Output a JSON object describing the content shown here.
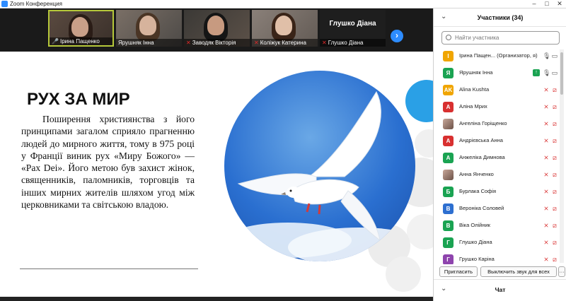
{
  "window": {
    "title": "Zoom Конференция",
    "controls": [
      "–",
      "□",
      "✕"
    ]
  },
  "video_strip": {
    "participants": [
      {
        "name": "Ірина Пащенко",
        "muted": false,
        "active": true
      },
      {
        "name": "Ярушняк Інна",
        "muted": false
      },
      {
        "name": "Заводяк Вікторія",
        "muted": true
      },
      {
        "name": "Коліжук Катерина",
        "muted": true
      },
      {
        "name": "Глушко Діана",
        "muted": true,
        "no_video": true
      }
    ],
    "next_arrow": "›"
  },
  "slide": {
    "heading": "РУХ ЗА МИР",
    "body": "Поширення християнства з його принципами загалом сприяло прагненню людей до мирного життя, тому в 975 році у Франції виник рух «Миру Божого» — «Pax Dei». Його метою був захист жінок, священників, паломників, торговців та інших мирних жителів шляхом угод між церковниками та світською владою."
  },
  "panel": {
    "chevron": "⌄",
    "title": "Участники (34)",
    "search_placeholder": "Найти участника",
    "participants": [
      {
        "initial": "I",
        "color": "#f0a500",
        "name": "Ірина Пащен... (Организатор, я)",
        "mic": "on",
        "cam": "on"
      },
      {
        "initial": "Я",
        "color": "#1aa352",
        "name": "Ярушняк Інна",
        "share": true,
        "mic": "on",
        "cam": "on"
      },
      {
        "initial": "AK",
        "color": "#f0a500",
        "name": "Alina Kushta",
        "mic": "off",
        "cam": "off"
      },
      {
        "initial": "А",
        "color": "#d83030",
        "name": "Аліна Мрих",
        "mic": "off",
        "cam": "off"
      },
      {
        "initial": "",
        "photo": true,
        "name": "Ангеліна Горіщенко",
        "mic": "off",
        "cam": "off"
      },
      {
        "initial": "А",
        "color": "#d83030",
        "name": "Андрієвська Анна",
        "mic": "off",
        "cam": "off"
      },
      {
        "initial": "А",
        "color": "#1aa352",
        "name": "Анжеліка Димнова",
        "mic": "off",
        "cam": "off"
      },
      {
        "initial": "",
        "photo": true,
        "name": "Анна Янченко",
        "mic": "off",
        "cam": "off"
      },
      {
        "initial": "Б",
        "color": "#1aa352",
        "name": "Бурлака Софія",
        "mic": "off",
        "cam": "off"
      },
      {
        "initial": "В",
        "color": "#2d6fd0",
        "name": "Вероніка Соловей",
        "mic": "off",
        "cam": "off"
      },
      {
        "initial": "В",
        "color": "#1aa352",
        "name": "Віка Олійник",
        "mic": "off",
        "cam": "off"
      },
      {
        "initial": "Г",
        "color": "#1aa352",
        "name": "Глушко Діана",
        "mic": "off",
        "cam": "off"
      },
      {
        "initial": "Г",
        "color": "#8e44ad",
        "name": "Грушко Каріна",
        "mic": "off",
        "cam": "off"
      }
    ],
    "invite_label": "Пригласить",
    "mute_all_label": "Выключить звук для всех",
    "more_label": "···",
    "chat_title": "Чат"
  }
}
